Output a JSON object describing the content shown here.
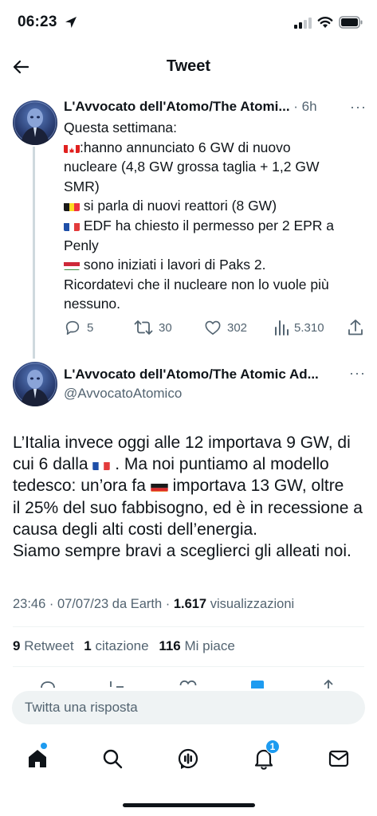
{
  "status_bar": {
    "time": "06:23"
  },
  "header": {
    "title": "Tweet"
  },
  "tweet1": {
    "name": "L'Avvocato dell'Atomo/The Atomi...",
    "meta": " · 6h",
    "lines": {
      "l1": "Questa settimana:",
      "l2": ":hanno annunciato 6 GW di nuovo",
      "l3": "nucleare (4,8 GW grossa taglia + 1,2 GW",
      "l4": "SMR)",
      "l5": " si parla di nuovi reattori (8 GW)",
      "l6": " EDF ha chiesto il permesso per 2 EPR a",
      "l7": "Penly",
      "l8": " sono iniziati i lavori di Paks 2.",
      "l9": "Ricordatevi che il nucleare non lo vuole più",
      "l10": "nessuno."
    },
    "actions": {
      "replies": "5",
      "retweets": "30",
      "likes": "302",
      "views": "5.310"
    }
  },
  "tweet2": {
    "name": "L'Avvocato dell'Atomo/The Atomic Ad...",
    "handle": "@AvvocatoAtomico",
    "lines": {
      "l1": "L’Italia invece oggi alle 12 importava 9 GW, di",
      "l2a": "cui 6 dalla ",
      "l2b": " . Ma noi puntiamo al modello",
      "l3a": "tedesco: un’ora fa ",
      "l3b": " importava 13 GW, oltre",
      "l4": "il 25% del suo fabbisogno, ed è in recessione a",
      "l5": "causa degli alti costi dell’energia.",
      "l6": "Siamo sempre bravi a sceglierci gli alleati noi."
    },
    "timestamp": "23:46 · 07/07/23 da Earth · ",
    "views_count": "1.617",
    "views_label": " visualizzazioni",
    "stats": {
      "retweets_count": "9",
      "retweets_label": " Retweet",
      "quotes_count": "1",
      "quotes_label": " citazione",
      "likes_count": "116",
      "likes_label": " Mi piace"
    }
  },
  "reply_box": {
    "placeholder": "Twitta una risposta"
  },
  "bottom_nav": {
    "notifications_badge": "1"
  },
  "colors": {
    "accent": "#1d9bf0",
    "text": "#0f1419",
    "secondary": "#536471",
    "divider": "#eff3f4"
  },
  "icons": [
    "location-arrow-icon",
    "cellular-signal-icon",
    "wifi-icon",
    "battery-icon",
    "back-arrow-icon",
    "reply-icon",
    "retweet-icon",
    "like-icon",
    "views-icon",
    "share-icon",
    "home-icon",
    "search-icon",
    "spaces-icon",
    "notifications-icon",
    "messages-icon"
  ]
}
